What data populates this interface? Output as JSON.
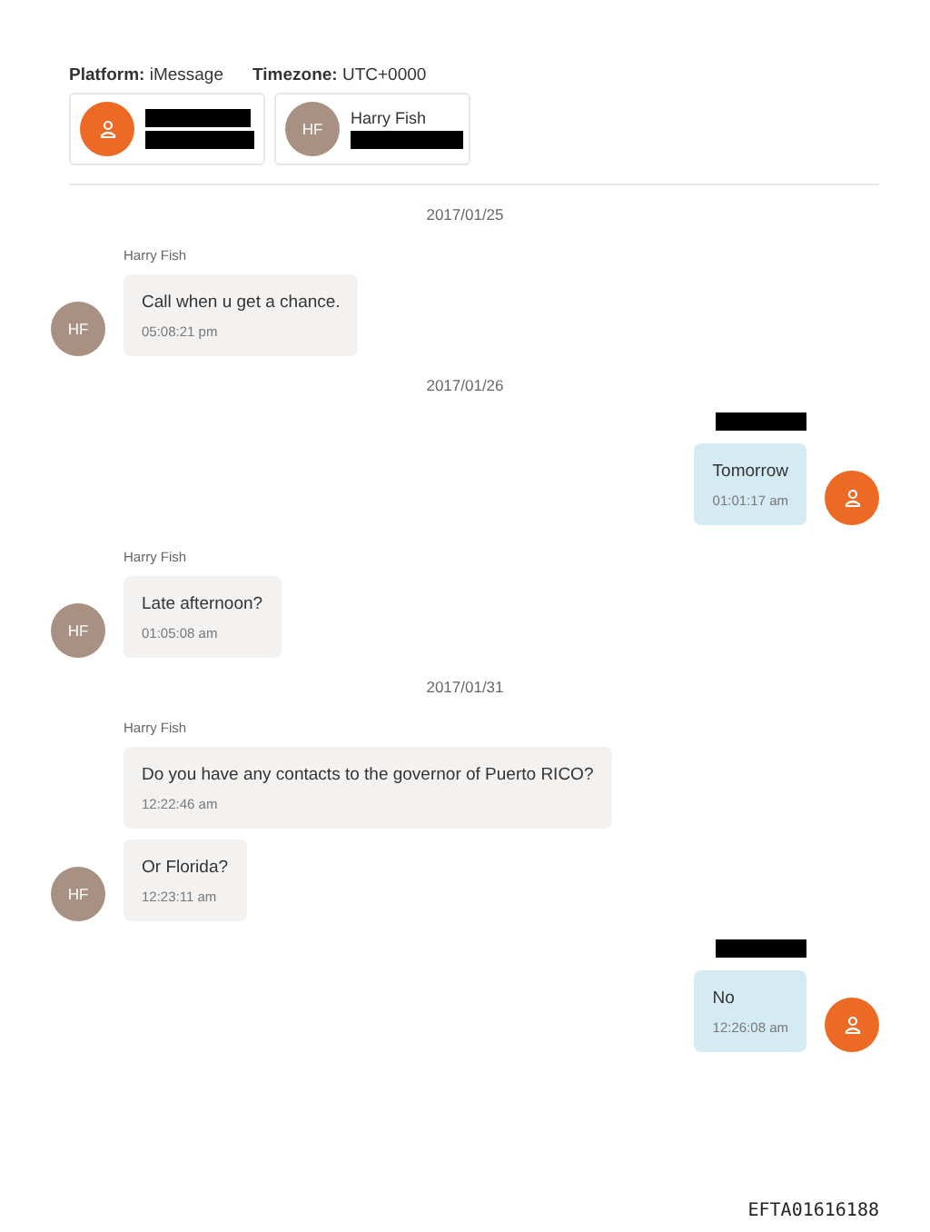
{
  "header": {
    "platform_label": "Platform:",
    "platform": "iMessage",
    "timezone_label": "Timezone:",
    "timezone": "UTC+0000"
  },
  "participants": [
    {
      "kind": "self",
      "redacted": true
    },
    {
      "kind": "contact",
      "initials": "HF",
      "name": "Harry Fish",
      "redacted": true
    }
  ],
  "timeline": [
    {
      "kind": "date",
      "text": "2017/01/25"
    },
    {
      "kind": "incoming",
      "sender": "Harry Fish",
      "initials": "HF",
      "messages": [
        {
          "text": "Call when u get a chance.",
          "time": "05:08:21 pm"
        }
      ]
    },
    {
      "kind": "date",
      "text": "2017/01/26"
    },
    {
      "kind": "outgoing",
      "sender_redacted": true,
      "messages": [
        {
          "text": "Tomorrow",
          "time": "01:01:17 am"
        }
      ]
    },
    {
      "kind": "incoming",
      "sender": "Harry Fish",
      "initials": "HF",
      "messages": [
        {
          "text": "Late afternoon?",
          "time": "01:05:08 am"
        }
      ]
    },
    {
      "kind": "date",
      "text": "2017/01/31"
    },
    {
      "kind": "incoming",
      "sender": "Harry Fish",
      "initials": "HF",
      "messages": [
        {
          "text": "Do you have any contacts to the governor of Puerto RICO?",
          "time": "12:22:46 am"
        },
        {
          "text": "Or Florida?",
          "time": "12:23:11 am"
        }
      ]
    },
    {
      "kind": "outgoing",
      "sender_redacted": true,
      "messages": [
        {
          "text": "No",
          "time": "12:26:08 am"
        }
      ]
    }
  ],
  "footer": "EFTA01616188"
}
